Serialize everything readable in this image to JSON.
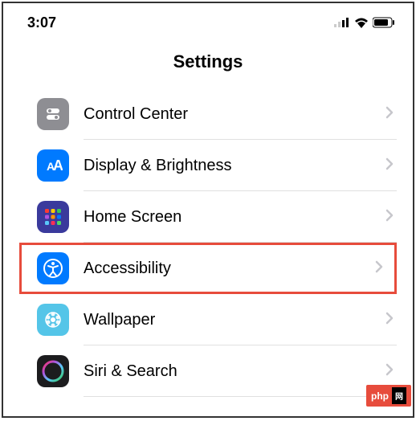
{
  "status": {
    "time": "3:07"
  },
  "header": {
    "title": "Settings"
  },
  "items": [
    {
      "label": "Control Center",
      "icon": "control-center"
    },
    {
      "label": "Display & Brightness",
      "icon": "display"
    },
    {
      "label": "Home Screen",
      "icon": "home-screen"
    },
    {
      "label": "Accessibility",
      "icon": "accessibility",
      "highlighted": true
    },
    {
      "label": "Wallpaper",
      "icon": "wallpaper"
    },
    {
      "label": "Siri & Search",
      "icon": "siri"
    }
  ],
  "watermark": {
    "text": "php",
    "suffix": "网"
  }
}
